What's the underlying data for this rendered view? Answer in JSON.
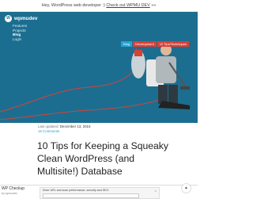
{
  "promo": {
    "prefix": "Hey, WordPress web developer :) ",
    "link": "Check out WPMU DEV",
    "suffix": " »»"
  },
  "brand": {
    "logo": "wpmudev",
    "logo_mark": "W"
  },
  "nav": {
    "items": [
      "Features",
      "Projects",
      "Blog",
      "Login"
    ],
    "active_index": 2
  },
  "tags": [
    "Blog",
    "Development",
    "10 Tips/Techniques"
  ],
  "meta": {
    "updated_label": "Last updated:",
    "updated_date": "December 13, 2016",
    "comments": "16 Comments"
  },
  "article": {
    "title": "10 Tips for Keeping a Squeaky Clean WordPress (and Multisite!) Database"
  },
  "checkup": {
    "name": "WP Checkup",
    "by": "by wpmudev",
    "prompt": "Enter URL and scan performance, security and SEO",
    "close": "×"
  },
  "scroll_top": {
    "glyph": "▲"
  },
  "colors": {
    "header_bg": "#1c6e90",
    "accent": "#27a2d2",
    "tag_red": "#d84138",
    "hose": "#d84138"
  }
}
